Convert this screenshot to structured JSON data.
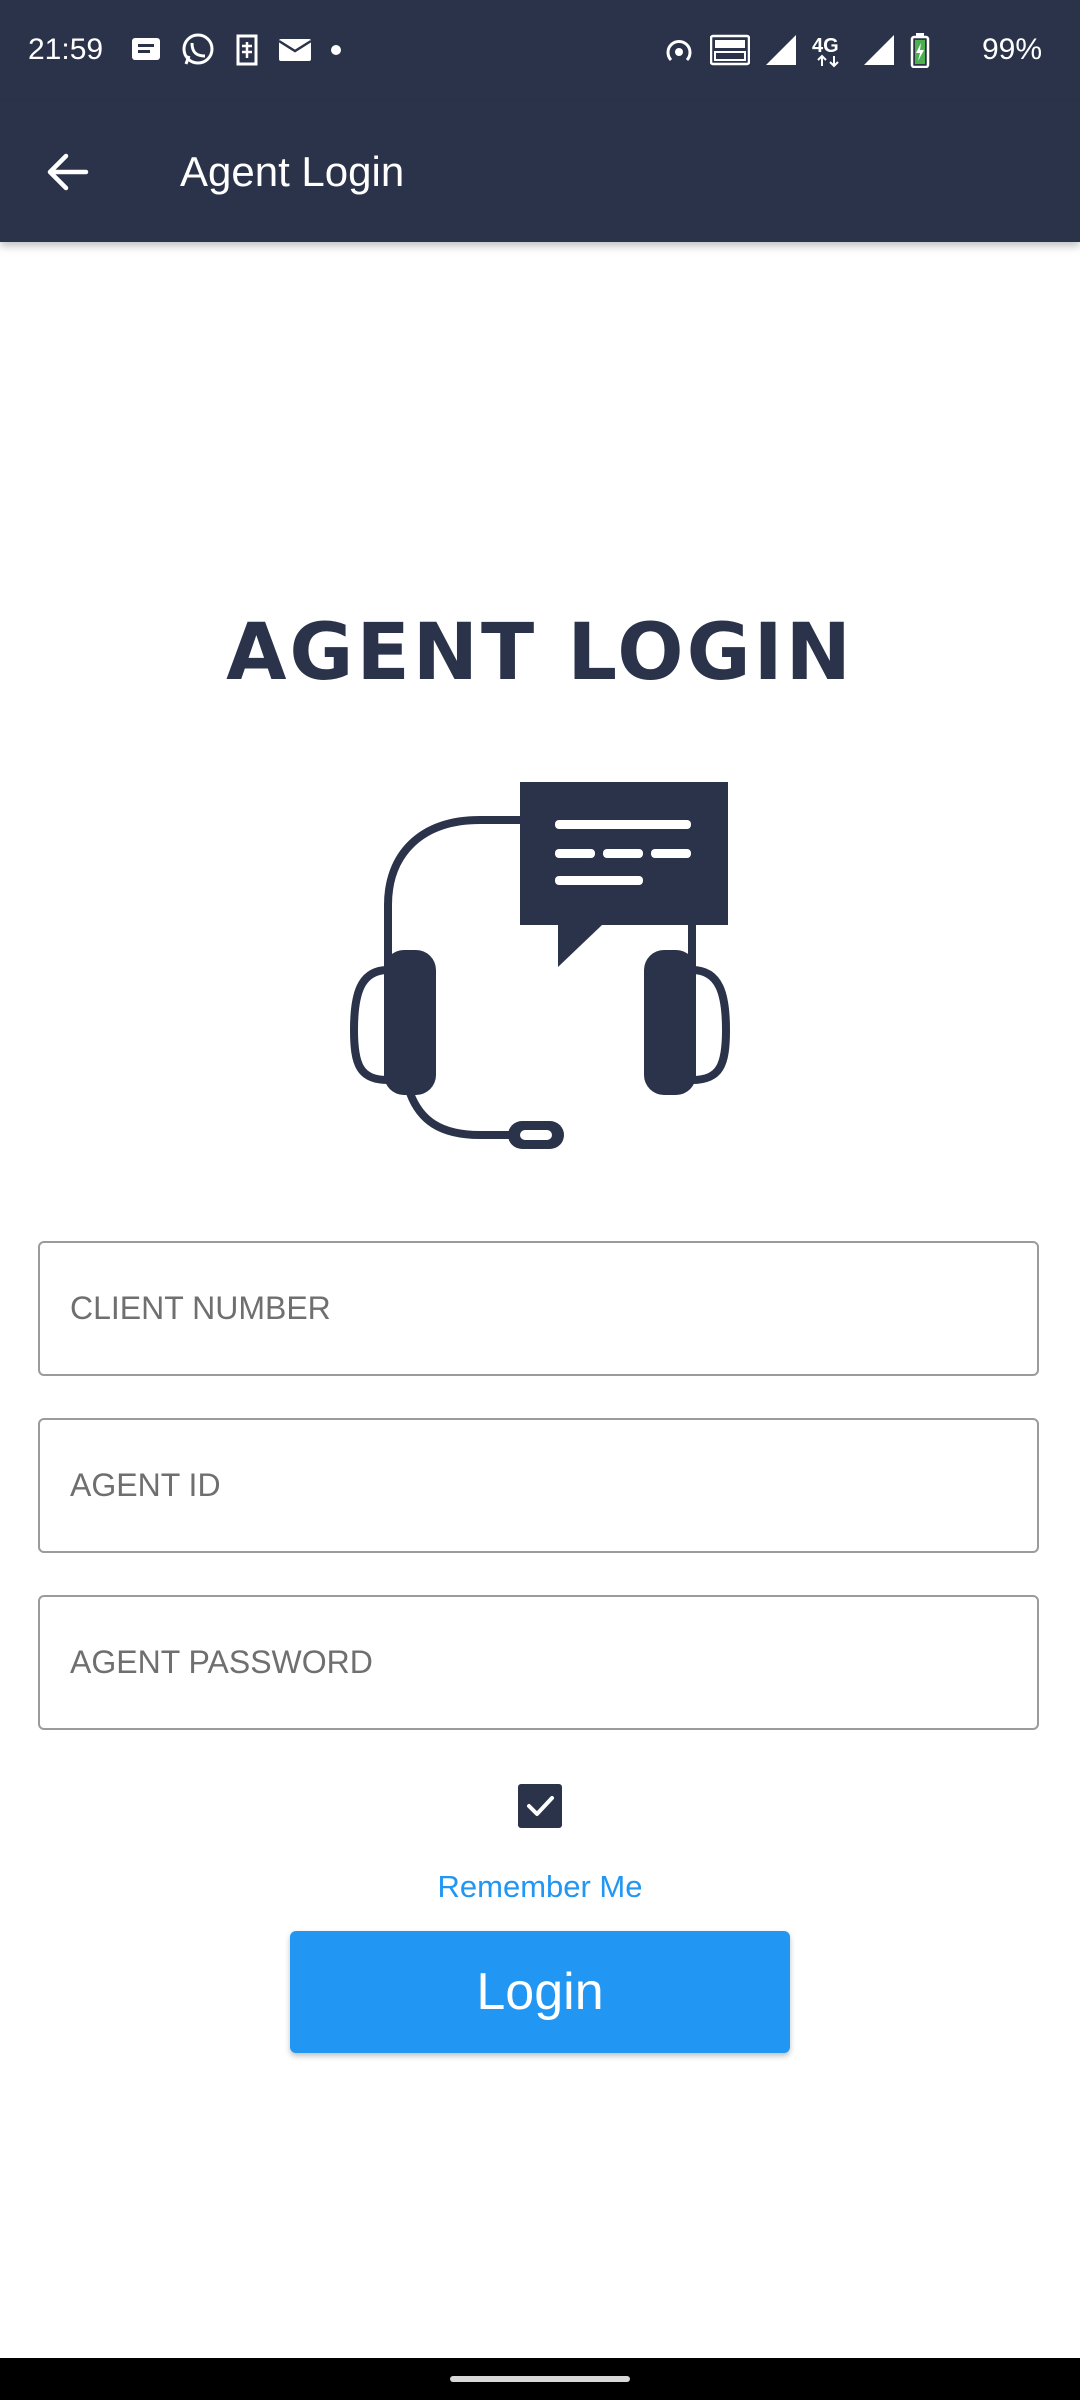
{
  "status_bar": {
    "time": "21:59",
    "battery": "99%",
    "left_icons": [
      "message-icon",
      "whatsapp-icon",
      "sim-icon",
      "mail-icon",
      "dot-icon"
    ],
    "right_icons": [
      "hotspot-icon",
      "volte-icon",
      "signal-icon",
      "4g-icon",
      "signal-icon",
      "battery-icon"
    ]
  },
  "app_bar": {
    "title": "Agent Login",
    "back_icon": "arrow-back-icon"
  },
  "heading": "AGENT LOGIN",
  "illustration_icon": "headset-chat-icon",
  "form": {
    "client_number_placeholder": "CLIENT NUMBER",
    "client_number_value": "",
    "agent_id_placeholder": "AGENT ID",
    "agent_id_value": "",
    "agent_password_placeholder": "AGENT PASSWORD",
    "agent_password_value": "",
    "remember_me_checked": true,
    "remember_me_label": "Remember Me",
    "login_label": "Login"
  },
  "colors": {
    "primary_dark": "#2b334a",
    "accent_blue": "#2196f3",
    "field_border": "#9b9b9b"
  }
}
